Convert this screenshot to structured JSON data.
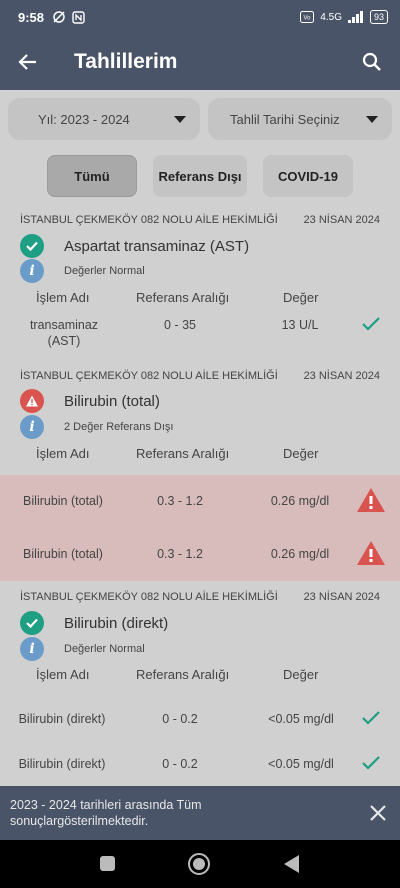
{
  "status": {
    "time": "9:58",
    "network": "4.5G",
    "battery": "93"
  },
  "appbar": {
    "title": "Tahlillerim"
  },
  "filters": {
    "year": "Yıl: 2023 - 2024",
    "date": "Tahlil Tarihi Seçiniz"
  },
  "tabs": [
    "Tümü",
    "Referans Dışı",
    "COVID-19"
  ],
  "results": [
    {
      "institution": "İSTANBUL ÇEKMEKÖY 082 NOLU AİLE HEKİMLİĞİ",
      "date": "23 NİSAN 2024",
      "test": "Aspartat transaminaz (AST)",
      "status": "Değerler Normal",
      "headers": {
        "name": "İşlem Adı",
        "range": "Referans Aralığı",
        "value": "Değer"
      },
      "rows": [
        {
          "name_line1": "transaminaz",
          "name_line2": "(AST)",
          "range": "0 - 35",
          "value": "13 U/L"
        }
      ]
    },
    {
      "institution": "İSTANBUL ÇEKMEKÖY 082 NOLU AİLE HEKİMLİĞİ",
      "date": "23 NİSAN 2024",
      "test": "Bilirubin (total)",
      "status": "2 Değer Referans Dışı",
      "headers": {
        "name": "İşlem Adı",
        "range": "Referans Aralığı",
        "value": "Değer"
      },
      "rows": [
        {
          "name": "Bilirubin (total)",
          "range": "0.3 - 1.2",
          "value": "0.26 mg/dl"
        },
        {
          "name": "Bilirubin (total)",
          "range": "0.3 - 1.2",
          "value": "0.26 mg/dl"
        }
      ]
    },
    {
      "institution": "İSTANBUL ÇEKMEKÖY 082 NOLU AİLE HEKİMLİĞİ",
      "date": "23 NİSAN 2024",
      "test": "Bilirubin (direkt)",
      "status": "Değerler Normal",
      "headers": {
        "name": "İşlem Adı",
        "range": "Referans Aralığı",
        "value": "Değer"
      },
      "rows": [
        {
          "name": "Bilirubin (direkt)",
          "range": "0 - 0.2",
          "value": "<0.05 mg/dl"
        },
        {
          "name": "Bilirubin (direkt)",
          "range": "0 - 0.2",
          "value": "<0.05 mg/dl"
        }
      ]
    }
  ],
  "snackbar": {
    "line1": "2023 - 2024 tarihleri arasında Tüm",
    "line2": "sonuçlargösterilmektedir."
  },
  "colors": {
    "appbar": "#4a5468",
    "ok": "#1e9e83",
    "warn": "#d9534f",
    "info": "#6b9bc9",
    "out_of_range_band": "#d8bcbc"
  }
}
